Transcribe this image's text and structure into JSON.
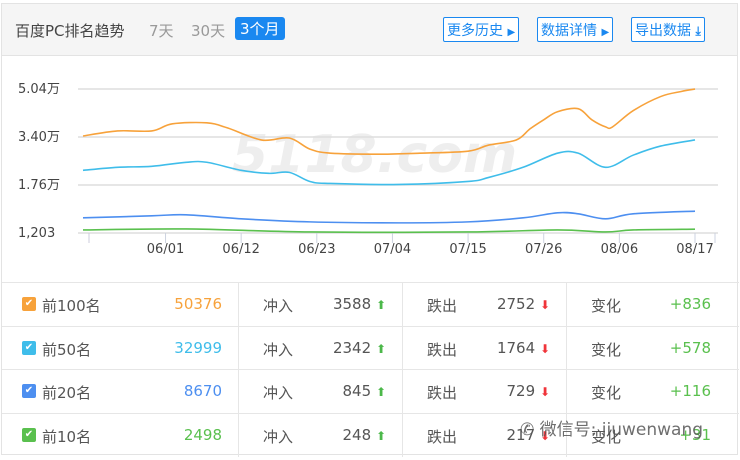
{
  "header": {
    "title": "百度PC排名趋势",
    "ranges": [
      "7天",
      "30天",
      "3个月"
    ],
    "active_range": "3个月",
    "buttons": {
      "history": "更多历史",
      "details": "数据详情",
      "export": "导出数据"
    }
  },
  "watermark": {
    "chart": "5118.com",
    "overlay": "微信号: jiuwenwang"
  },
  "chart_data": {
    "type": "line",
    "title": "",
    "xlabel": "",
    "ylabel": "",
    "y_ticks": [
      "1,203",
      "1.76万",
      "3.40万",
      "5.04万"
    ],
    "ylim": [
      1203,
      50403
    ],
    "x_ticks": [
      "06/01",
      "06/12",
      "06/23",
      "07/04",
      "07/15",
      "07/26",
      "08/06",
      "08/17"
    ],
    "x_start": "05/20",
    "x_end": "08/17",
    "series": [
      {
        "name": "前100名",
        "color": "#f7a23b",
        "points": [
          [
            "05/20",
            34350
          ],
          [
            "05/25",
            36080
          ],
          [
            "05/30",
            36080
          ],
          [
            "06/02",
            38500
          ],
          [
            "06/07",
            38840
          ],
          [
            "06/10",
            37110
          ],
          [
            "06/15",
            32970
          ],
          [
            "06/19",
            33660
          ],
          [
            "06/22",
            29860
          ],
          [
            "06/25",
            28480
          ],
          [
            "07/02",
            28140
          ],
          [
            "07/08",
            28480
          ],
          [
            "07/15",
            29170
          ],
          [
            "07/18",
            31240
          ],
          [
            "07/22",
            32970
          ],
          [
            "07/24",
            36770
          ],
          [
            "07/26",
            39880
          ],
          [
            "07/28",
            42640
          ],
          [
            "07/31",
            43670
          ],
          [
            "08/02",
            39880
          ],
          [
            "08/04",
            37460
          ],
          [
            "08/05",
            37460
          ],
          [
            "08/08",
            42990
          ],
          [
            "08/12",
            47820
          ],
          [
            "08/15",
            49550
          ],
          [
            "08/17",
            50376
          ]
        ]
      },
      {
        "name": "前50名",
        "color": "#3fbdea",
        "points": [
          [
            "05/20",
            22610
          ],
          [
            "05/25",
            23650
          ],
          [
            "05/30",
            23990
          ],
          [
            "06/04",
            25370
          ],
          [
            "06/07",
            25370
          ],
          [
            "06/12",
            22610
          ],
          [
            "06/16",
            21580
          ],
          [
            "06/19",
            21920
          ],
          [
            "06/22",
            18810
          ],
          [
            "06/25",
            18120
          ],
          [
            "07/05",
            17780
          ],
          [
            "07/15",
            18810
          ],
          [
            "07/18",
            20190
          ],
          [
            "07/23",
            23650
          ],
          [
            "07/28",
            28480
          ],
          [
            "07/31",
            28480
          ],
          [
            "08/04",
            23650
          ],
          [
            "08/08",
            27790
          ],
          [
            "08/12",
            30900
          ],
          [
            "08/17",
            32999
          ]
        ]
      },
      {
        "name": "前20名",
        "color": "#4d8ff0",
        "points": [
          [
            "05/20",
            6380
          ],
          [
            "05/30",
            7070
          ],
          [
            "06/04",
            7420
          ],
          [
            "06/12",
            6040
          ],
          [
            "06/22",
            5000
          ],
          [
            "07/05",
            4660
          ],
          [
            "07/15",
            5000
          ],
          [
            "07/23",
            6380
          ],
          [
            "07/28",
            8110
          ],
          [
            "07/31",
            7760
          ],
          [
            "08/04",
            6040
          ],
          [
            "08/08",
            7760
          ],
          [
            "08/17",
            8670
          ]
        ]
      },
      {
        "name": "前10名",
        "color": "#5ac04e",
        "points": [
          [
            "05/20",
            2240
          ],
          [
            "06/04",
            2580
          ],
          [
            "06/22",
            1550
          ],
          [
            "07/15",
            1550
          ],
          [
            "07/28",
            2240
          ],
          [
            "08/04",
            1550
          ],
          [
            "08/08",
            2240
          ],
          [
            "08/17",
            2498
          ]
        ]
      }
    ]
  },
  "rows": [
    {
      "label": "前100名",
      "total": "50376",
      "color": "#f7a23b",
      "in_label": "冲入",
      "in": "3588",
      "out_label": "跌出",
      "out": "2752",
      "change_label": "变化",
      "change": "+836"
    },
    {
      "label": "前50名",
      "total": "32999",
      "color": "#3fbdea",
      "in_label": "冲入",
      "in": "2342",
      "out_label": "跌出",
      "out": "1764",
      "change_label": "变化",
      "change": "+578"
    },
    {
      "label": "前20名",
      "total": "8670",
      "color": "#4d8ff0",
      "in_label": "冲入",
      "in": "845",
      "out_label": "跌出",
      "out": "729",
      "change_label": "变化",
      "change": "+116"
    },
    {
      "label": "前10名",
      "total": "2498",
      "color": "#5ac04e",
      "in_label": "冲入",
      "in": "248",
      "out_label": "跌出",
      "out": "217",
      "change_label": "变化",
      "change": "+31"
    }
  ]
}
